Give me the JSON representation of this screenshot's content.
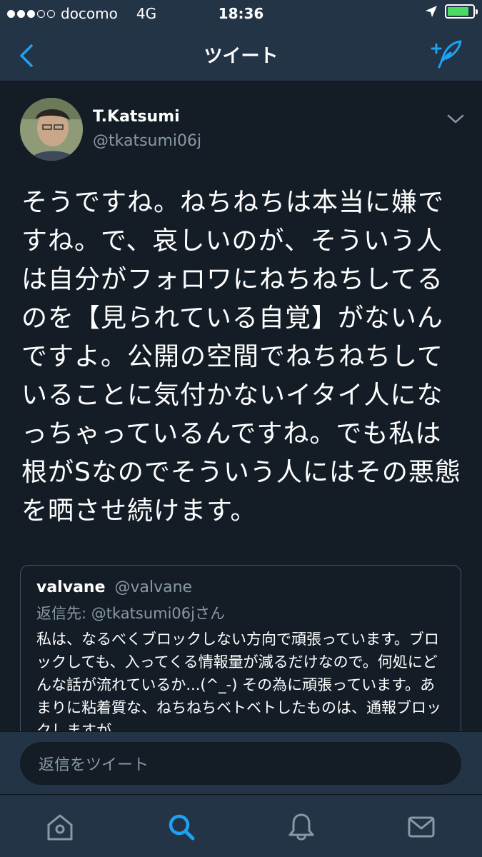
{
  "status_bar": {
    "carrier": "docomo",
    "network": "4G",
    "time": "18:36",
    "signal_bars": 3,
    "signal_total": 5,
    "battery_level": 0.85
  },
  "nav": {
    "title": "ツイート"
  },
  "tweet": {
    "author_name": "T.Katsumi",
    "author_handle": "@tkatsumi06j",
    "text": "そうですね。ねちねちは本当に嫌ですね。で、哀しいのが、そういう人は自分がフォロワにねちねちしてるのを【見られている自覚】がないんですよ。公開の空間でねちねちしていることに気付かないイタイ人になっちゃっているんですね。でも私は根がSなのでそういう人にはその悪態を晒させ続けます。"
  },
  "quoted_tweet": {
    "name": "valvane",
    "handle": "@valvane",
    "reply_to": "返信先: @tkatsumi06jさん",
    "text": "私は、なるべくブロックしない方向で頑張っています。ブロックしても、入ってくる情報量が減るだけなので。何処にどんな話が流れているか...(^_-) その為に頑張っています。あまりに粘着質な、ねちねちベトベトしたものは、通報ブロックしますが"
  },
  "reply": {
    "placeholder": "返信をツイート"
  },
  "colors": {
    "background": "#141d26",
    "bar": "#243447",
    "accent": "#1da1f2",
    "secondary_text": "#8899a6",
    "battery": "#4cd964"
  },
  "tabs": [
    {
      "icon": "home-icon",
      "active": false
    },
    {
      "icon": "search-icon",
      "active": true
    },
    {
      "icon": "bell-icon",
      "active": false
    },
    {
      "icon": "mail-icon",
      "active": false
    }
  ]
}
